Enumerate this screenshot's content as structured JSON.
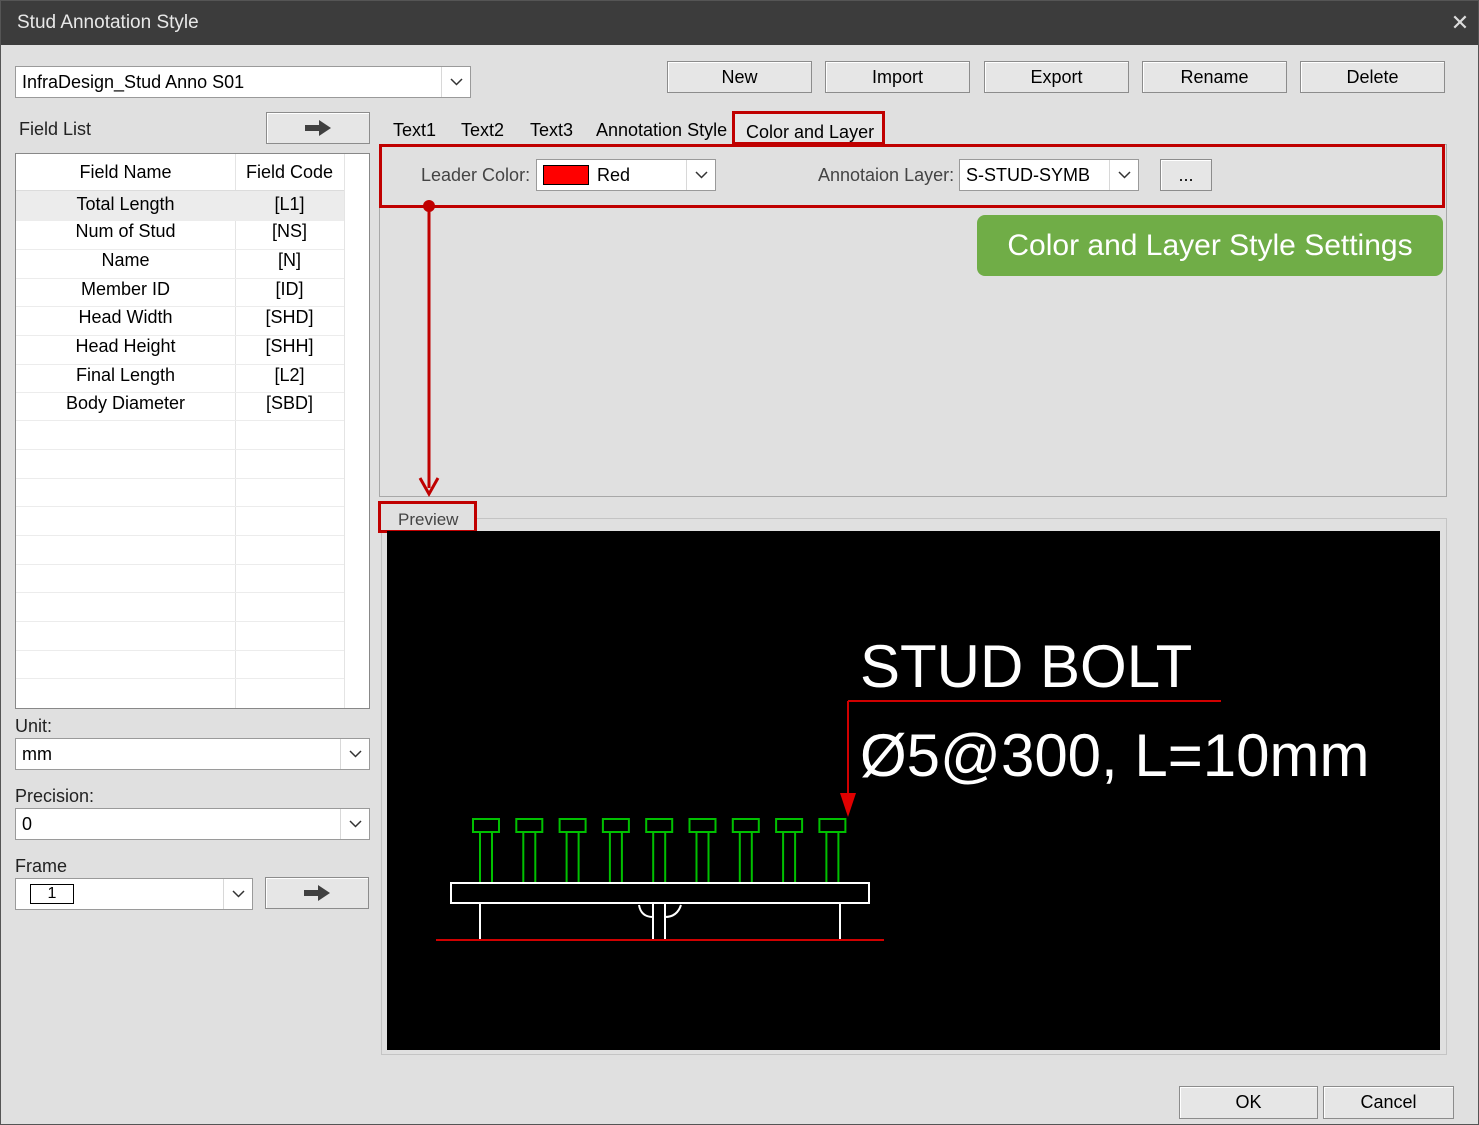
{
  "window": {
    "title": "Stud Annotation Style"
  },
  "style_selector": {
    "value": "InfraDesign_Stud Anno S01"
  },
  "toolbar": {
    "new": "New",
    "import": "Import",
    "export": "Export",
    "rename": "Rename",
    "delete": "Delete"
  },
  "field_list": {
    "label": "Field List",
    "headers": {
      "name": "Field Name",
      "code": "Field Code"
    },
    "rows": [
      {
        "name": "Total Length",
        "code": "[L1]"
      },
      {
        "name": "Num of Stud",
        "code": "[NS]"
      },
      {
        "name": "Name",
        "code": "[N]"
      },
      {
        "name": "Member ID",
        "code": "[ID]"
      },
      {
        "name": "Head Width",
        "code": "[SHD]"
      },
      {
        "name": "Head Height",
        "code": "[SHH]"
      },
      {
        "name": "Final Length",
        "code": "[L2]"
      },
      {
        "name": "Body Diameter",
        "code": "[SBD]"
      }
    ]
  },
  "unit": {
    "label": "Unit:",
    "value": "mm"
  },
  "precision": {
    "label": "Precision:",
    "value": "0"
  },
  "frame": {
    "label": "Frame",
    "value": "1"
  },
  "tabs": [
    "Text1",
    "Text2",
    "Text3",
    "Annotation Style",
    "Color and Layer"
  ],
  "color_layer": {
    "leader_color_label": "Leader Color:",
    "leader_color_value": "Red",
    "leader_color_swatch": "#ff0000",
    "layer_label": "Annotaion Layer:",
    "layer_value": "S-STUD-SYMB",
    "browse_label": "..."
  },
  "callout": {
    "text": "Color and Layer Style Settings",
    "color": "#70ad47"
  },
  "preview": {
    "label": "Preview",
    "line1": "STUD BOLT",
    "line2": "Ø5@300, L=10mm",
    "stud_count": 9,
    "stud_color": "#00c000",
    "leader_color": "#ff0000"
  },
  "footer": {
    "ok": "OK",
    "cancel": "Cancel"
  }
}
